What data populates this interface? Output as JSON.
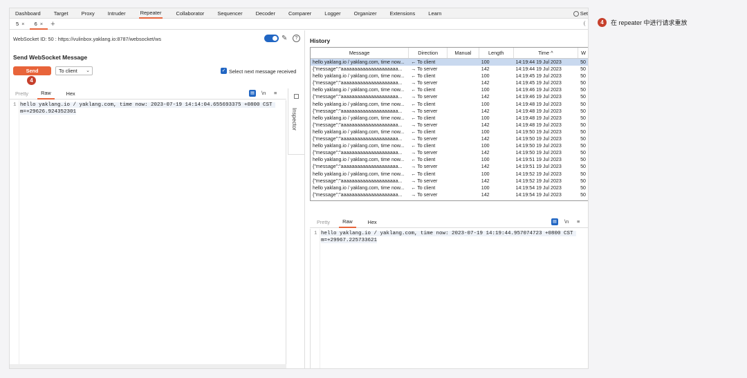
{
  "menubar": {
    "items": [
      "Dashboard",
      "Target",
      "Proxy",
      "Intruder",
      "Repeater",
      "Collaborator",
      "Sequencer",
      "Decoder",
      "Comparer",
      "Logger",
      "Organizer",
      "Extensions",
      "Learn"
    ],
    "active": "Repeater",
    "settings_label": "Set"
  },
  "tabs": [
    {
      "label": "5",
      "close": "×"
    },
    {
      "label": "6",
      "close": "×"
    }
  ],
  "tabs_add": "+",
  "left": {
    "ws_id": "WebSocket ID: 50 : https://vulinbox.yaklang.io:8787/websocket/ws",
    "help": "?",
    "send_title": "Send WebSocket Message",
    "send_button": "Send",
    "direction_select": "To client",
    "checkbox_label": "Select next message received",
    "editor_tabs": [
      "Pretty",
      "Raw",
      "Hex"
    ],
    "editor_tools": [
      "\\n",
      "≡"
    ],
    "line_number": "1",
    "code": "hello yaklang.io / yaklang.com, time now: 2023-07-19 14:14:04.655693375 +0800 CST m=+29626.924352301",
    "inspector_label": "Inspector"
  },
  "badge": "4",
  "history": {
    "title": "History",
    "columns": [
      "Message",
      "Direction",
      "Manual",
      "Length",
      "Time ^",
      "W"
    ],
    "rows": [
      {
        "message": "hello yaklang.io / yaklang.com, time now...",
        "direction": "← To client",
        "length": "100",
        "time": "14:19:44 19 Jul 2023",
        "w": "50"
      },
      {
        "message": "{\"message\":\"aaaaaaaaaaaaaaaaaaaaa...",
        "direction": "→ To server",
        "length": "142",
        "time": "14:19:44 19 Jul 2023",
        "w": "50"
      },
      {
        "message": "hello yaklang.io / yaklang.com, time now...",
        "direction": "← To client",
        "length": "100",
        "time": "14:19:45 19 Jul 2023",
        "w": "50"
      },
      {
        "message": "{\"message\":\"aaaaaaaaaaaaaaaaaaaaa...",
        "direction": "→ To server",
        "length": "142",
        "time": "14:19:45 19 Jul 2023",
        "w": "50"
      },
      {
        "message": "hello yaklang.io / yaklang.com, time now...",
        "direction": "← To client",
        "length": "100",
        "time": "14:19:46 19 Jul 2023",
        "w": "50"
      },
      {
        "message": "{\"message\":\"aaaaaaaaaaaaaaaaaaaaa...",
        "direction": "→ To server",
        "length": "142",
        "time": "14:19:46 19 Jul 2023",
        "w": "50"
      },
      {
        "message": "hello yaklang.io / yaklang.com, time now...",
        "direction": "← To client",
        "length": "100",
        "time": "14:19:48 19 Jul 2023",
        "w": "50"
      },
      {
        "message": "{\"message\":\"aaaaaaaaaaaaaaaaaaaaa...",
        "direction": "→ To server",
        "length": "142",
        "time": "14:19:48 19 Jul 2023",
        "w": "50"
      },
      {
        "message": "hello yaklang.io / yaklang.com, time now...",
        "direction": "← To client",
        "length": "100",
        "time": "14:19:48 19 Jul 2023",
        "w": "50"
      },
      {
        "message": "{\"message\":\"aaaaaaaaaaaaaaaaaaaaa...",
        "direction": "→ To server",
        "length": "142",
        "time": "14:19:48 19 Jul 2023",
        "w": "50"
      },
      {
        "message": "hello yaklang.io / yaklang.com, time now...",
        "direction": "← To client",
        "length": "100",
        "time": "14:19:50 19 Jul 2023",
        "w": "50"
      },
      {
        "message": "{\"message\":\"aaaaaaaaaaaaaaaaaaaaa...",
        "direction": "→ To server",
        "length": "142",
        "time": "14:19:50 19 Jul 2023",
        "w": "50"
      },
      {
        "message": "hello yaklang.io / yaklang.com, time now...",
        "direction": "← To client",
        "length": "100",
        "time": "14:19:50 19 Jul 2023",
        "w": "50"
      },
      {
        "message": "{\"message\":\"aaaaaaaaaaaaaaaaaaaaa...",
        "direction": "→ To server",
        "length": "142",
        "time": "14:19:50 19 Jul 2023",
        "w": "50"
      },
      {
        "message": "hello yaklang.io / yaklang.com, time now...",
        "direction": "← To client",
        "length": "100",
        "time": "14:19:51 19 Jul 2023",
        "w": "50"
      },
      {
        "message": "{\"message\":\"aaaaaaaaaaaaaaaaaaaaa...",
        "direction": "→ To server",
        "length": "142",
        "time": "14:19:51 19 Jul 2023",
        "w": "50"
      },
      {
        "message": "hello yaklang.io / yaklang.com, time now...",
        "direction": "← To client",
        "length": "100",
        "time": "14:19:52 19 Jul 2023",
        "w": "50"
      },
      {
        "message": "{\"message\":\"aaaaaaaaaaaaaaaaaaaaa...",
        "direction": "→ To server",
        "length": "142",
        "time": "14:19:52 19 Jul 2023",
        "w": "50"
      },
      {
        "message": "hello yaklang.io / yaklang.com, time now...",
        "direction": "← To client",
        "length": "100",
        "time": "14:19:54 19 Jul 2023",
        "w": "50"
      },
      {
        "message": "{\"message\":\"aaaaaaaaaaaaaaaaaaaaa...",
        "direction": "→ To server",
        "length": "142",
        "time": "14:19:54 19 Jul 2023",
        "w": "50"
      }
    ]
  },
  "response": {
    "tabs": [
      "Pretty",
      "Raw",
      "Hex"
    ],
    "tools": [
      "\\n",
      "≡"
    ],
    "line_number": "1",
    "code": "hello yaklang.io / yaklang.com, time now: 2023-07-19 14:19:44.957074723 +0800 CST m=+29967.225733621"
  },
  "annotation": {
    "badge": "4",
    "text": "在 repeater 中进行请求重放"
  },
  "colors": {
    "accent": "#e8643a",
    "selection": "#c9d9ef",
    "toggle": "#2166c3",
    "badge": "#c6402c"
  }
}
